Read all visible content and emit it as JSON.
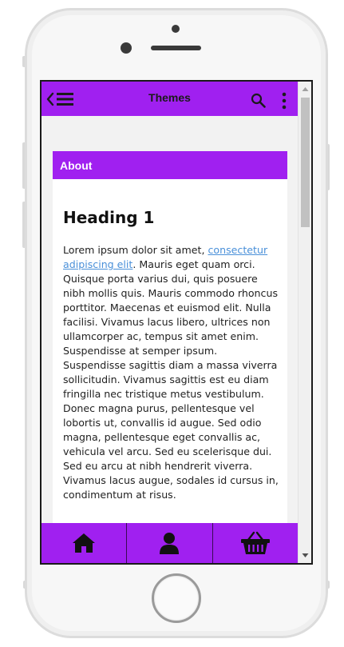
{
  "app": {
    "title": "Themes"
  },
  "card": {
    "header": "About",
    "heading": "Heading 1",
    "paragraph_before_link": "Lorem ipsum dolor sit amet, ",
    "link_text": "consectetur adipiscing elit",
    "paragraph_after_link": ". Mauris eget quam orci. Quisque porta varius dui, quis posuere nibh mollis quis. Mauris commodo rhoncus porttitor. Maecenas et euismod elit. Nulla facilisi. Vivamus lacus libero, ultrices non ullamcorper ac, tempus sit amet enim. Suspendisse at semper ipsum. Suspendisse sagittis diam a massa viverra sollicitudin. Vivamus sagittis est eu diam fringilla nec tristique metus vestibulum. Donec magna purus, pellentesque vel lobortis ut, convallis id augue. Sed odio magna, pellentesque eget convallis ac, vehicula vel arcu. Sed eu scelerisque dui. Sed eu arcu at nibh hendrerit viverra. Vivamus lacus augue, sodales id cursus in, condimentum at risus."
  },
  "topbar_icons": [
    "back-menu-icon",
    "search-icon",
    "more-vertical-icon"
  ],
  "bottom_nav": [
    {
      "icon": "home-icon"
    },
    {
      "icon": "user-icon"
    },
    {
      "icon": "basket-icon"
    }
  ],
  "colors": {
    "accent": "#a020f0",
    "link": "#4a90d9",
    "screen_background": "#f2f2f2"
  }
}
